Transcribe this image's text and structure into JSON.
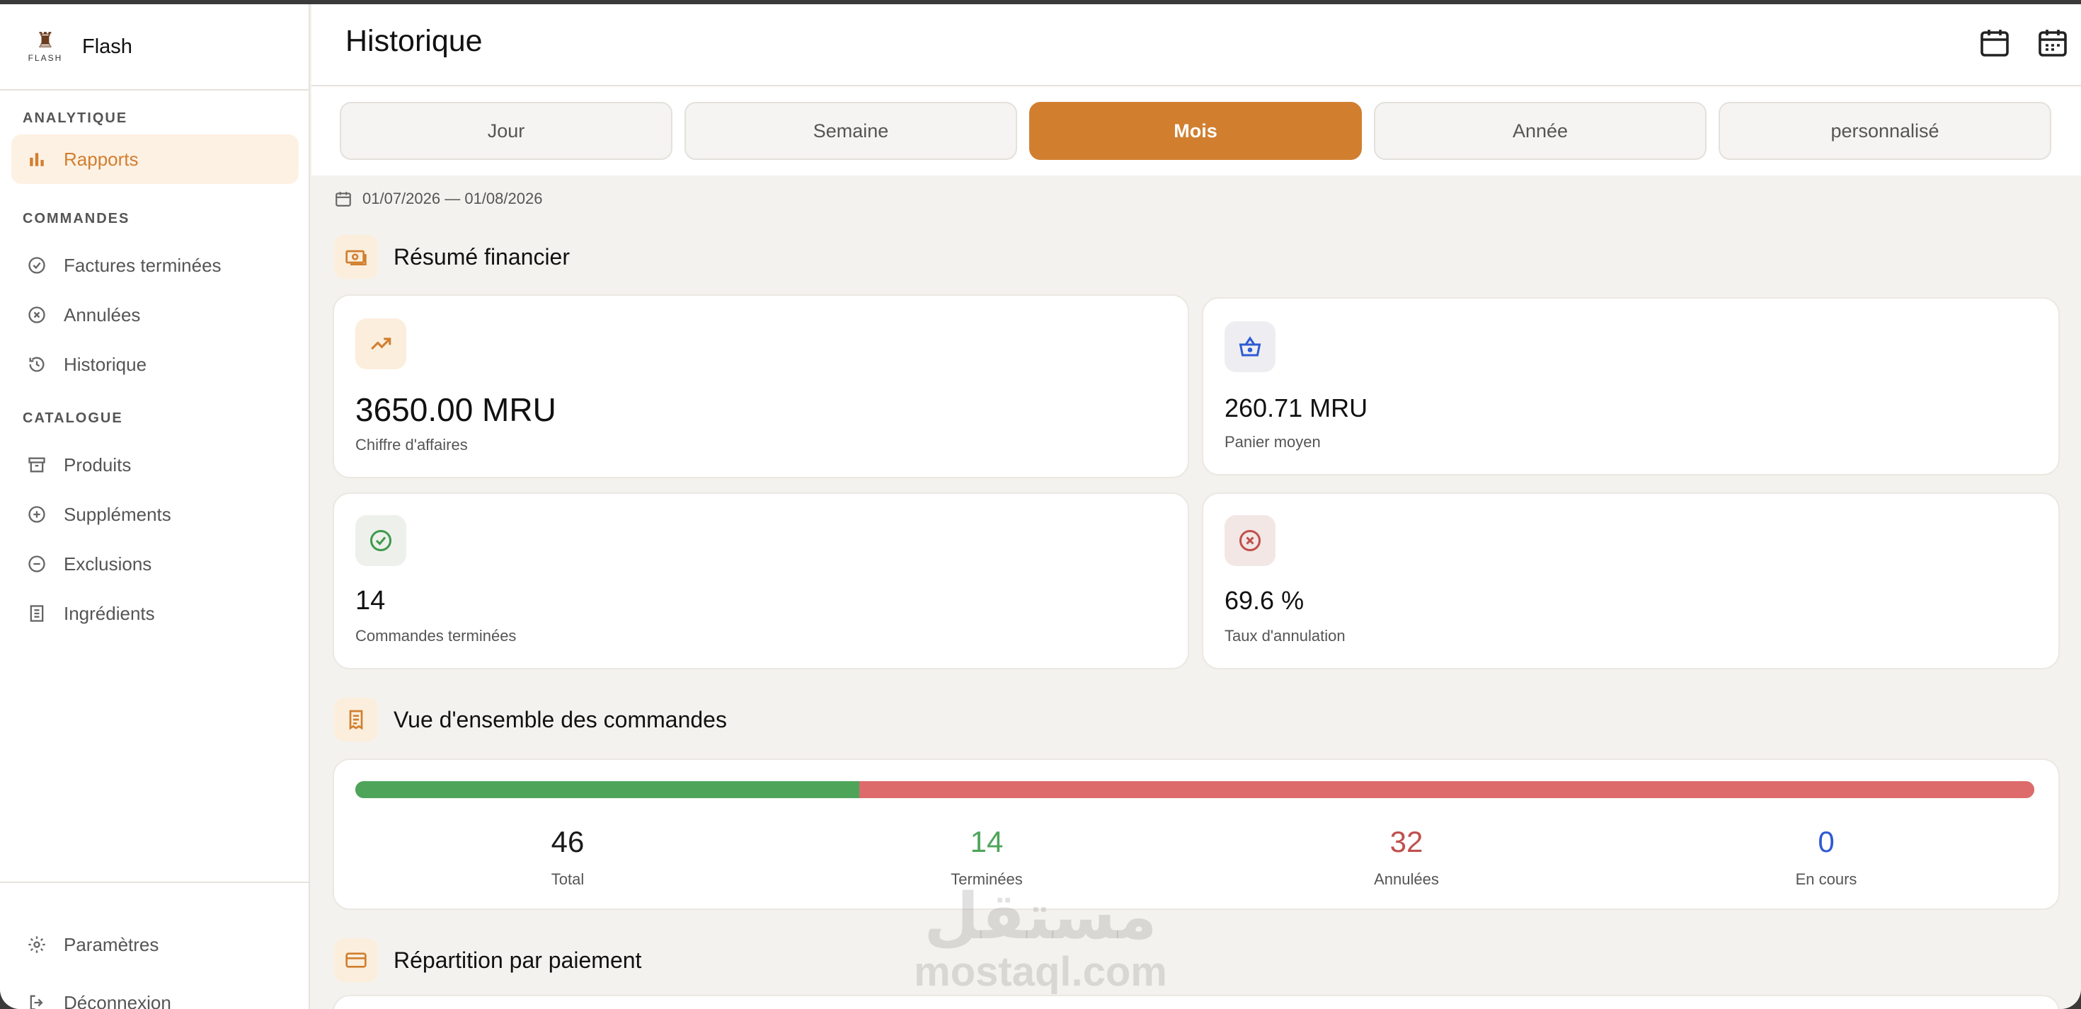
{
  "app": {
    "name": "Flash",
    "logo_text": "FLASH"
  },
  "sidebar": {
    "sections": [
      {
        "title": "ANALYTIQUE",
        "items": [
          {
            "label": "Rapports",
            "icon": "bar-chart-icon",
            "active": true
          }
        ]
      },
      {
        "title": "COMMANDES",
        "items": [
          {
            "label": "Factures terminées",
            "icon": "check-circle-icon"
          },
          {
            "label": "Annulées",
            "icon": "x-circle-icon"
          },
          {
            "label": "Historique",
            "icon": "history-icon"
          }
        ]
      },
      {
        "title": "CATALOGUE",
        "items": [
          {
            "label": "Produits",
            "icon": "archive-icon"
          },
          {
            "label": "Suppléments",
            "icon": "plus-circle-icon"
          },
          {
            "label": "Exclusions",
            "icon": "minus-circle-icon"
          },
          {
            "label": "Ingrédients",
            "icon": "list-icon"
          }
        ]
      }
    ],
    "footer": [
      {
        "label": "Paramètres",
        "icon": "gear-icon"
      },
      {
        "label": "Déconnexion",
        "icon": "logout-icon"
      }
    ]
  },
  "header": {
    "title": "Historique"
  },
  "tabs": [
    {
      "label": "Jour"
    },
    {
      "label": "Semaine"
    },
    {
      "label": "Mois",
      "active": true
    },
    {
      "label": "Année"
    },
    {
      "label": "personnalisé"
    }
  ],
  "date_range": "01/07/2026 — 01/08/2026",
  "financial": {
    "title": "Résumé financier",
    "cards": [
      {
        "value": "3650.00 MRU",
        "label": "Chiffre d'affaires",
        "icon": "trending-up-icon"
      },
      {
        "value": "260.71 MRU",
        "label": "Panier moyen",
        "icon": "basket-icon"
      },
      {
        "value": "14",
        "label": "Commandes terminées",
        "icon": "check-circle-icon"
      },
      {
        "value": "69.6 %",
        "label": "Taux d'annulation",
        "icon": "x-circle-icon"
      }
    ]
  },
  "overview": {
    "title": "Vue d'ensemble des commandes",
    "completed_fraction": 0.3,
    "stats": [
      {
        "value": "46",
        "label": "Total",
        "color": "#1a1a1a"
      },
      {
        "value": "14",
        "label": "Terminées",
        "color": "#4ea55a"
      },
      {
        "value": "32",
        "label": "Annulées",
        "color": "#c0504d"
      },
      {
        "value": "0",
        "label": "En cours",
        "color": "#2f5bd3"
      }
    ]
  },
  "payment": {
    "title": "Répartition par paiement"
  },
  "watermark": {
    "arabic": "مستقل",
    "latin": "mostaql.com"
  },
  "colors": {
    "accent": "#d17f2f",
    "accent_bg": "#fdf1e4",
    "success": "#4ea55a",
    "danger": "#dd6b6b",
    "info": "#2f5bd3"
  }
}
